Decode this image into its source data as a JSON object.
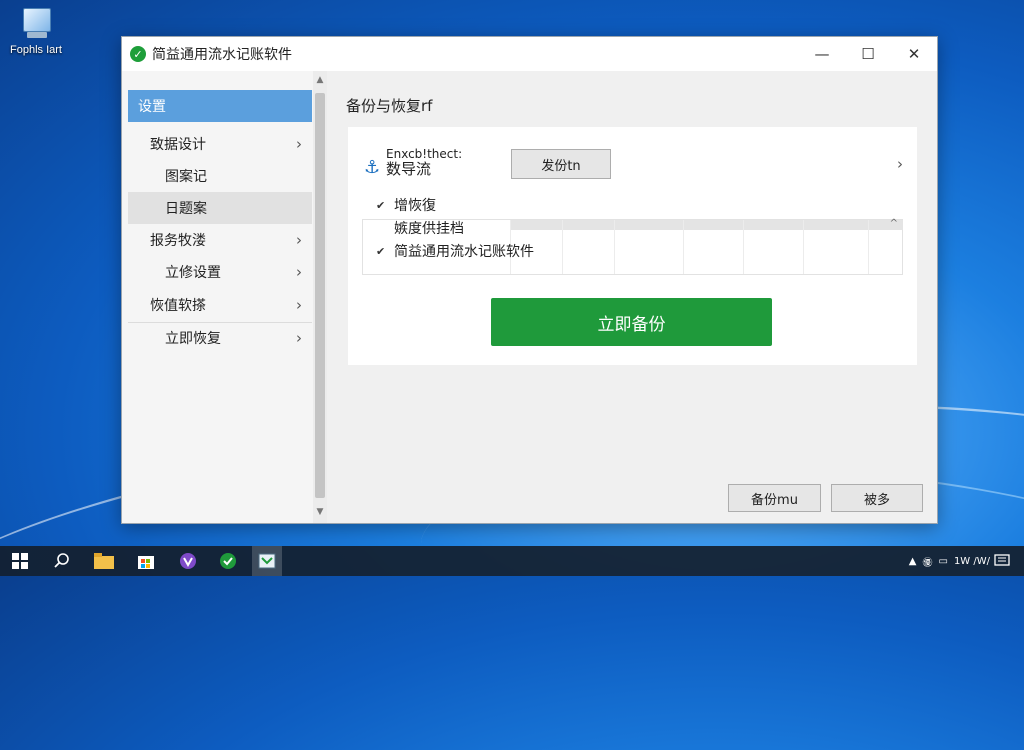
{
  "desktop": {
    "icon_label": "Fophls Iart"
  },
  "window": {
    "title": "简益通用流水记账软件",
    "minimize": "—",
    "maximize": "☐",
    "close": "✕"
  },
  "sidebar": {
    "items": [
      {
        "label": "设置",
        "chevron": ""
      },
      {
        "label": "致据设计",
        "chevron": "›"
      },
      {
        "label": "图案记",
        "chevron": ""
      },
      {
        "label": "日题案",
        "chevron": ""
      },
      {
        "label": "报务牧溇",
        "chevron": "›"
      },
      {
        "label": "立修设置",
        "chevron": "›"
      },
      {
        "label": "恢值软搽",
        "chevron": "›"
      },
      {
        "label": "立即恢复",
        "chevron": "›"
      }
    ]
  },
  "main": {
    "section_title": "备份与恢复rf",
    "row1": {
      "line1": "Enxcb!thect:",
      "line2": "数导流",
      "button": "发份tn",
      "chevron": "›"
    },
    "checks": [
      {
        "mark": "✔",
        "label": "增恢復"
      },
      {
        "mark": "",
        "label": "嫉度供挂档"
      },
      {
        "mark": "✔",
        "label": "简益通用流水记账软件"
      }
    ],
    "grid_up": "^",
    "primary_button": "立即备份",
    "footer_buttons": [
      "备份mu",
      "被多"
    ]
  },
  "taskbar": {
    "tray": [
      "▲",
      "㊝",
      "▭",
      "1W /W/"
    ]
  },
  "colors": {
    "accent_green": "#1f9a3b",
    "sidebar_active": "#5b9fdd"
  }
}
